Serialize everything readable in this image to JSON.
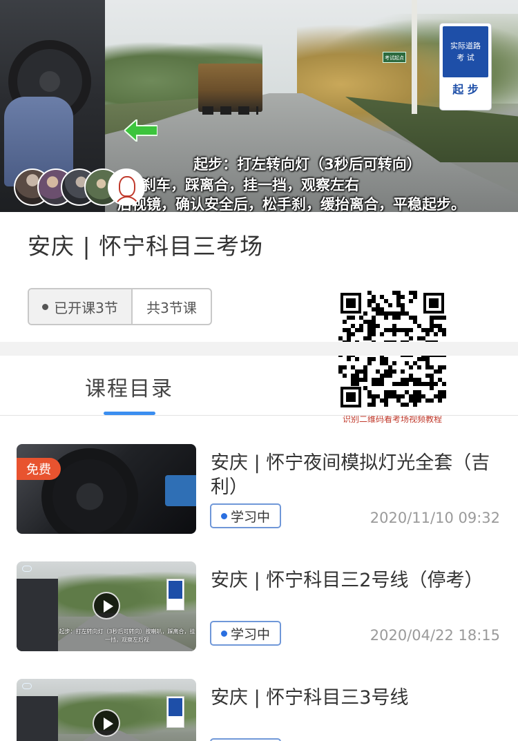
{
  "hero": {
    "subtitle_line1": "起步：打左转向灯（3秒后可转向）",
    "subtitle_line2": "按喇叭，踩刹车，踩离合，挂一挡，观察左右",
    "subtitle_line3": "后视镜，确认安全后，松手刹，缓抬离合，平稳起步。",
    "sign_line1": "实际道路",
    "sign_line2": "考 试",
    "sign_action": "起 步",
    "small_sign": "考试起点",
    "avatars": [
      "avatar-1",
      "avatar-2",
      "avatar-3",
      "avatar-4",
      "avatar-5"
    ]
  },
  "course": {
    "title": "安庆 | 怀宁科目三考场",
    "opened": "已开课3节",
    "total": "共3节课"
  },
  "qr": {
    "caption": "识别二维码看考场视频教程"
  },
  "tabs": {
    "catalog": "课程目录"
  },
  "lessons": [
    {
      "title": "安庆 | 怀宁夜间模拟灯光全套（吉利）",
      "badge": "免费",
      "status": "学习中",
      "date": "2020/11/10 09:32",
      "thumb_icon": "steering-wheel"
    },
    {
      "title": "安庆 | 怀宁科目三2号线（停考）",
      "status": "学习中",
      "date": "2020/04/22 18:15",
      "thumb_icon": "play-icon",
      "thumb_caption": "起步：打左转向灯（3秒后可转向）按喇叭，踩离合，挂一挡，观察左后视"
    },
    {
      "title": "安庆 | 怀宁科目三3号线",
      "thumb_icon": "play-icon"
    }
  ],
  "colors": {
    "accent": "#3b8ef0",
    "badge": "#e8532f",
    "status_border": "#6f97d8",
    "qr_caption": "#c0392b"
  }
}
